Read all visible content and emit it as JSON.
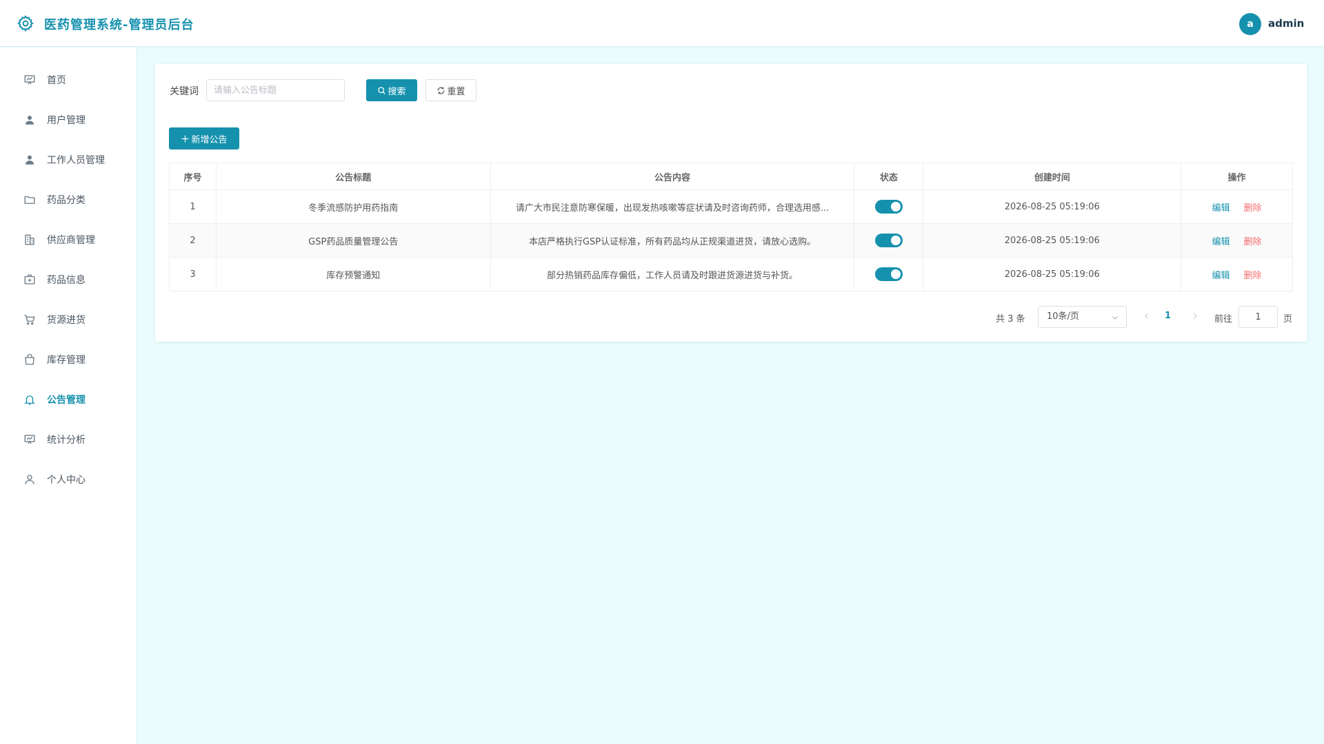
{
  "header": {
    "title": "医药管理系统-管理员后台",
    "user_initial": "a",
    "user_name": "admin"
  },
  "sidebar": {
    "items": [
      {
        "label": "首页",
        "icon": "dashboard-icon"
      },
      {
        "label": "用户管理",
        "icon": "user-icon"
      },
      {
        "label": "工作人员管理",
        "icon": "staff-icon"
      },
      {
        "label": "药品分类",
        "icon": "folder-icon"
      },
      {
        "label": "供应商管理",
        "icon": "building-icon"
      },
      {
        "label": "药品信息",
        "icon": "medkit-icon"
      },
      {
        "label": "货源进货",
        "icon": "cart-icon"
      },
      {
        "label": "库存管理",
        "icon": "bag-icon"
      },
      {
        "label": "公告管理",
        "icon": "bell-icon"
      },
      {
        "label": "统计分析",
        "icon": "chart-icon"
      },
      {
        "label": "个人中心",
        "icon": "profile-icon"
      }
    ],
    "active_index": 8
  },
  "search": {
    "label": "关键词",
    "placeholder": "请输入公告标题",
    "search_label": "搜索",
    "reset_label": "重置"
  },
  "toolbar": {
    "add_label": "新增公告"
  },
  "table": {
    "headers": [
      "序号",
      "公告标题",
      "公告内容",
      "状态",
      "创建时间",
      "操作"
    ],
    "rows": [
      {
        "no": "1",
        "title": "冬季流感防护用药指南",
        "content": "请广大市民注意防寒保暖，出现发热咳嗽等症状请及时咨询药师，合理选用感...",
        "status": true,
        "created": "2026-08-25 05:19:06",
        "edit": "编辑",
        "delete": "删除"
      },
      {
        "no": "2",
        "title": "GSP药品质量管理公告",
        "content": "本店严格执行GSP认证标准，所有药品均从正规渠道进货，请放心选购。",
        "status": true,
        "created": "2026-08-25 05:19:06",
        "edit": "编辑",
        "delete": "删除"
      },
      {
        "no": "3",
        "title": "库存预警通知",
        "content": "部分热销药品库存偏低，工作人员请及时跟进货源进货与补货。",
        "status": true,
        "created": "2026-08-25 05:19:06",
        "edit": "编辑",
        "delete": "删除"
      }
    ]
  },
  "pagination": {
    "total": "共 3 条",
    "page_size": "10条/页",
    "current_page": "1",
    "goto_label": "前往",
    "goto_value": "1",
    "page_suffix": "页"
  },
  "colors": {
    "accent": "#1591ad",
    "danger": "#f56c6c",
    "background": "#eafcfe"
  }
}
